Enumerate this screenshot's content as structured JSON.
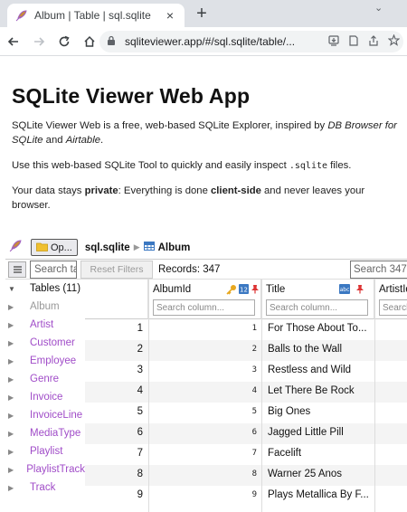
{
  "browser": {
    "tab_title": "Album | Table | sql.sqlite",
    "close_glyph": "×",
    "newtab_glyph": "+",
    "tabmenu_glyph": "⌄",
    "url": "sqliteviewer.app/#/sql.sqlite/table/...",
    "icons": [
      "back-arrow-icon",
      "forward-arrow-icon",
      "reload-icon",
      "home-icon",
      "lock-icon",
      "install-icon",
      "bookmark-page-icon",
      "share-icon",
      "star-icon"
    ]
  },
  "page": {
    "title": "SQLite Viewer Web App",
    "intro": {
      "before_db": "SQLite Viewer Web is a free, web-based SQLite Explorer, inspired by ",
      "db_browser": "DB Browser for SQLite",
      "and": " and ",
      "airtable": "Airtable",
      "end": "."
    },
    "tool": {
      "before": "Use this web-based SQLite Tool to quickly and easily inspect ",
      "code": ".sqlite",
      "after": " files."
    },
    "privacy": {
      "a": "Your data stays ",
      "private": "private",
      "b": ": Everything is done ",
      "client": "client-side",
      "c": " and never leaves your browser."
    }
  },
  "app": {
    "open_button": "Op...",
    "breadcrumb_db": "sql.sqlite",
    "breadcrumb_table": "Album",
    "table_search_value": "Search ta",
    "reset_filters": "Reset Filters",
    "records": "Records: 347",
    "global_search": "Search 347",
    "tree": [
      {
        "label": "Tables (11)",
        "root": true
      },
      {
        "label": "Album",
        "muted": true
      },
      {
        "label": "Artist"
      },
      {
        "label": "Customer"
      },
      {
        "label": "Employee"
      },
      {
        "label": "Genre"
      },
      {
        "label": "Invoice"
      },
      {
        "label": "InvoiceLine"
      },
      {
        "label": "MediaType"
      },
      {
        "label": "Playlist"
      },
      {
        "label": "PlaylistTrack"
      },
      {
        "label": "Track"
      }
    ],
    "columns": [
      {
        "name": "AlbumId",
        "search": "Search column..."
      },
      {
        "name": "Title",
        "search": "Search column..."
      },
      {
        "name": "ArtistId",
        "search": "Search"
      }
    ],
    "rows": [
      {
        "n": "1",
        "id": "1",
        "title": "For Those About To..."
      },
      {
        "n": "2",
        "id": "2",
        "title": "Balls to the Wall"
      },
      {
        "n": "3",
        "id": "3",
        "title": "Restless and Wild"
      },
      {
        "n": "4",
        "id": "4",
        "title": "Let There Be Rock"
      },
      {
        "n": "5",
        "id": "5",
        "title": "Big Ones"
      },
      {
        "n": "6",
        "id": "6",
        "title": "Jagged Little Pill"
      },
      {
        "n": "7",
        "id": "7",
        "title": "Facelift"
      },
      {
        "n": "8",
        "id": "8",
        "title": "Warner 25 Anos"
      },
      {
        "n": "9",
        "id": "9",
        "title": "Plays Metallica By F..."
      }
    ]
  }
}
